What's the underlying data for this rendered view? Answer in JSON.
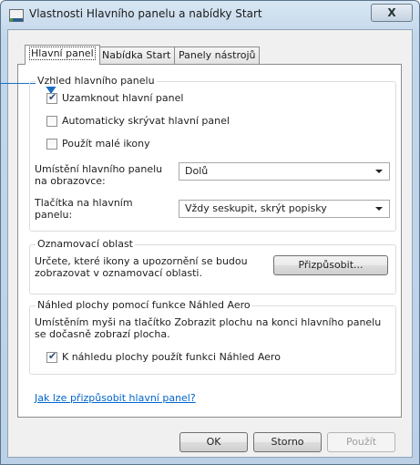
{
  "window": {
    "title": "Vlastnosti Hlavního panelu a nabídky Start",
    "close_label": "X"
  },
  "tabs": [
    {
      "label": "Hlavní panel",
      "active": true
    },
    {
      "label": "Nabídka Start",
      "active": false
    },
    {
      "label": "Panely nástrojů",
      "active": false
    }
  ],
  "appearance_group": {
    "legend": "Vzhled hlavního panelu",
    "lock_taskbar": {
      "label": "Uzamknout hlavní panel",
      "checked": true
    },
    "autohide": {
      "label": "Automaticky skrývat hlavní panel",
      "checked": false
    },
    "small_icons": {
      "label": "Použít malé ikony",
      "checked": false
    },
    "location_label": "Umístění hlavního panelu na obrazovce:",
    "location_value": "Dolů",
    "buttons_label": "Tlačítka na hlavním panelu:",
    "buttons_value": "Vždy seskupit, skrýt popisky"
  },
  "notification_group": {
    "legend": "Oznamovací oblast",
    "description": "Určete, které ikony a upozornění se budou zobrazovat v oznamovací oblasti.",
    "customize_button": "Přizpůsobit..."
  },
  "aero_group": {
    "legend": "Náhled plochy pomocí funkce Náhled Aero",
    "description": "Umístěním myši na tlačítko Zobrazit plochu na konci hlavního panelu se dočasně zobrazí plocha.",
    "aero_peek": {
      "label": "K náhledu plochy použít funkci Náhled Aero",
      "checked": true
    }
  },
  "help_link": "Jak lze přizpůsobit hlavní panel?",
  "footer": {
    "ok": "OK",
    "cancel": "Storno",
    "apply": "Použít"
  },
  "colors": {
    "accent": "#1a6fc4",
    "link": "#0066cc"
  }
}
